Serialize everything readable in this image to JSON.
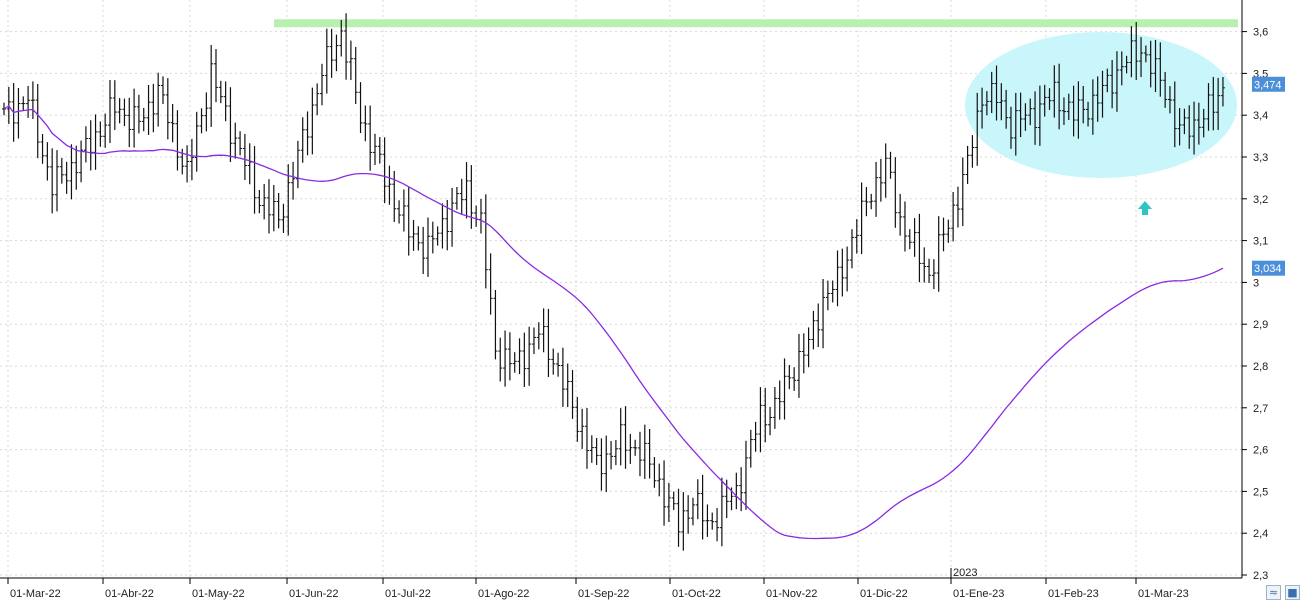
{
  "chart_data": {
    "type": "ohlc",
    "x_labels": [
      "01-Mar-22",
      "01-Abr-22",
      "01-May-22",
      "01-Jun-22",
      "01-Jul-22",
      "01-Ago-22",
      "01-Sep-22",
      "01-Oct-22",
      "01-Nov-22",
      "01-Dic-22",
      "01-Ene-23",
      "01-Feb-23",
      "01-Mar-23"
    ],
    "year_marker": "2023",
    "y_ticks": [
      "3,6",
      "3,5",
      "3,4",
      "3,3",
      "3,2",
      "3,1",
      "3",
      "2,9",
      "2,8",
      "2,7",
      "2,6",
      "2,5",
      "2,4",
      "2,3"
    ],
    "ylim": [
      2.3,
      3.65
    ],
    "grid": true,
    "price_label": "3,474",
    "ma_label": "3,034",
    "price_close": 3.474,
    "ma_value": 3.034,
    "resistance_level": 3.62,
    "colors": {
      "bars": "#111111",
      "moving_average": "#8a2be2",
      "resistance": "#b8f0b0",
      "ellipse": "#c8f6fa",
      "arrow": "#2ec4c4",
      "label_bg": "#4a8fd8"
    },
    "ohlc_anchors": [
      [
        0,
        3.4
      ],
      [
        5,
        3.44
      ],
      [
        10,
        3.23
      ],
      [
        16,
        3.3
      ],
      [
        23,
        3.42
      ],
      [
        28,
        3.38
      ],
      [
        32,
        3.46
      ],
      [
        38,
        3.26
      ],
      [
        43,
        3.5
      ],
      [
        48,
        3.34
      ],
      [
        53,
        3.2
      ],
      [
        57,
        3.15
      ],
      [
        61,
        3.3
      ],
      [
        66,
        3.5
      ],
      [
        70,
        3.6
      ],
      [
        74,
        3.4
      ],
      [
        79,
        3.25
      ],
      [
        84,
        3.12
      ],
      [
        88,
        3.08
      ],
      [
        93,
        3.18
      ],
      [
        96,
        3.22
      ],
      [
        99,
        3.14
      ],
      [
        102,
        2.84
      ],
      [
        106,
        2.8
      ],
      [
        111,
        2.88
      ],
      [
        114,
        2.82
      ],
      [
        118,
        2.7
      ],
      [
        123,
        2.56
      ],
      [
        128,
        2.62
      ],
      [
        132,
        2.6
      ],
      [
        136,
        2.52
      ],
      [
        140,
        2.42
      ],
      [
        143,
        2.48
      ],
      [
        146,
        2.42
      ],
      [
        149,
        2.46
      ],
      [
        152,
        2.5
      ],
      [
        157,
        2.68
      ],
      [
        160,
        2.7
      ],
      [
        164,
        2.8
      ],
      [
        167,
        2.85
      ],
      [
        170,
        2.96
      ],
      [
        173,
        3.0
      ],
      [
        176,
        3.1
      ],
      [
        180,
        3.22
      ],
      [
        183,
        3.28
      ],
      [
        186,
        3.15
      ],
      [
        189,
        3.08
      ],
      [
        192,
        3.02
      ],
      [
        196,
        3.14
      ],
      [
        200,
        3.28
      ],
      [
        203,
        3.45
      ],
      [
        206,
        3.44
      ],
      [
        209,
        3.38
      ],
      [
        213,
        3.4
      ],
      [
        218,
        3.45
      ],
      [
        222,
        3.4
      ],
      [
        227,
        3.44
      ],
      [
        232,
        3.52
      ],
      [
        236,
        3.56
      ],
      [
        238,
        3.52
      ],
      [
        241,
        3.46
      ],
      [
        244,
        3.36
      ],
      [
        247,
        3.38
      ],
      [
        251,
        3.42
      ],
      [
        253,
        3.47
      ]
    ]
  }
}
